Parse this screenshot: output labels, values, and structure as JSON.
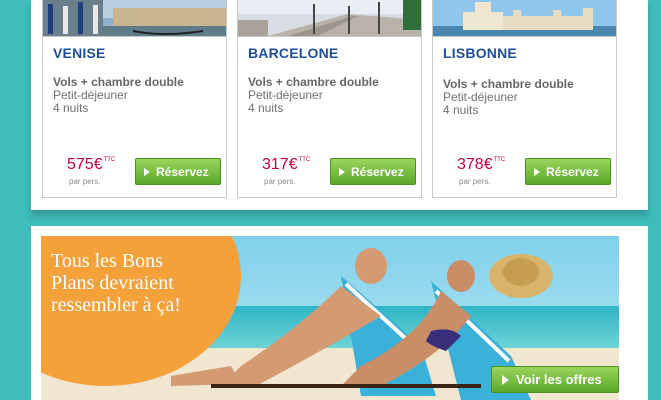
{
  "cards": [
    {
      "city": "VENISE",
      "line1": "Vols + chambre double",
      "line2": "Petit-déjeuner",
      "line3": "4 nuits",
      "price": "575€",
      "price_sup": "TTC",
      "per_person": "par pers.",
      "button": "Réservez"
    },
    {
      "city": "BARCELONE",
      "line1": "Vols + chambre double",
      "line2": "Petit-déjeuner",
      "line3": "4 nuits",
      "price": "317€",
      "price_sup": "TTC",
      "per_person": "par pers.",
      "button": "Réservez"
    },
    {
      "city": "LISBONNE",
      "line1": "Vols + chambre double",
      "line2": "Petit-déjeuner",
      "line3": "4 nuits",
      "price": "378€",
      "price_sup": "TTC",
      "per_person": "par pers.",
      "button": "Réservez"
    }
  ],
  "banner": {
    "headline_1": "Tous les Bons",
    "headline_2": "Plans devraient",
    "headline_3": "ressembler à ça!",
    "button": "Voir les offres"
  },
  "colors": {
    "background": "#3fbcbc",
    "city_blue": "#1f4f9c",
    "price_red": "#c6003d",
    "button_green": "#5aa82a",
    "orange": "#f5a13a"
  },
  "icons": {
    "button": "play-icon"
  }
}
